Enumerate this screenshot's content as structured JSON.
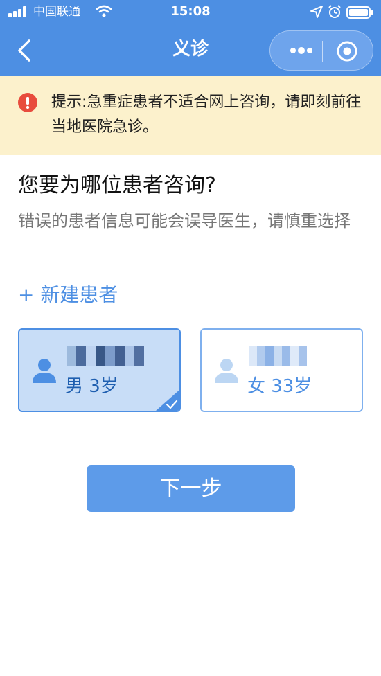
{
  "status_bar": {
    "carrier": "中国联通",
    "time": "15:08",
    "icons": [
      "signal-icon",
      "wifi-icon",
      "location-icon",
      "alarm-icon",
      "battery-icon"
    ]
  },
  "nav": {
    "title": "义诊",
    "icons": [
      "back-icon",
      "more-icon",
      "close-target-icon"
    ]
  },
  "warning": {
    "icon": "alert-icon",
    "text": "提示:急重症患者不适合网上咨询，请即刻前往当地医院急诊。",
    "bg_color": "#fcf1cc",
    "icon_color": "#e84c3d"
  },
  "question": {
    "title": "您要为哪位患者咨询?",
    "description": "错误的患者信息可能会误导医生，请慎重选择"
  },
  "new_patient": {
    "plus": "+",
    "label": "新建患者"
  },
  "patients": [
    {
      "info": "男 3岁",
      "selected": true,
      "name_obscured": true
    },
    {
      "info": "女 33岁",
      "selected": false,
      "name_obscured": true
    }
  ],
  "next_button": {
    "label": "下一步"
  },
  "colors": {
    "primary": "#4d8fe3",
    "button": "#5d9be9",
    "selected_card_bg": "#c8ddf7"
  }
}
